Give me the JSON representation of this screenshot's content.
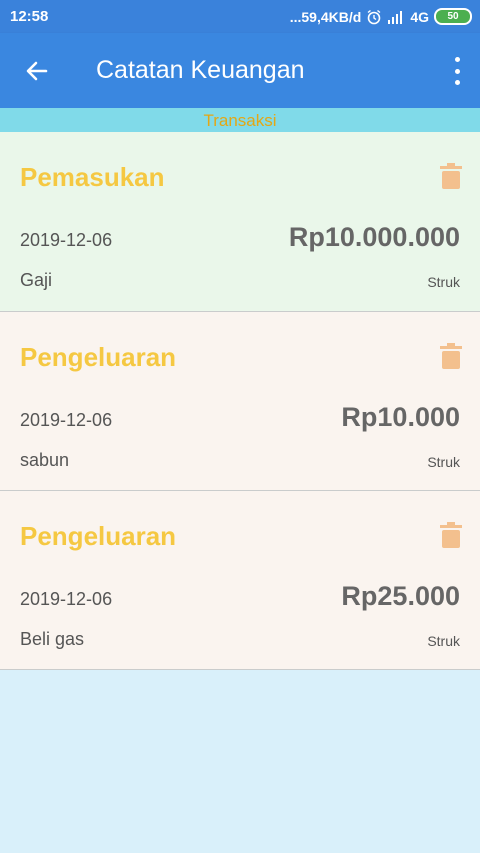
{
  "status_bar": {
    "time": "12:58",
    "network_speed": "...59,4KB/d",
    "network": "4G",
    "battery": "50"
  },
  "app_bar": {
    "title": "Catatan Keuangan",
    "back_icon": "arrow-left-icon",
    "menu_icon": "more-vert-icon"
  },
  "tab": {
    "label": "Transaksi"
  },
  "transactions": [
    {
      "type": "Pemasukan",
      "date": "2019-12-06",
      "amount": "Rp10.000.000",
      "description": "Gaji",
      "receipt_label": "Struk"
    },
    {
      "type": "Pengeluaran",
      "date": "2019-12-06",
      "amount": "Rp10.000",
      "description": "sabun",
      "receipt_label": "Struk"
    },
    {
      "type": "Pengeluaran",
      "date": "2019-12-06",
      "amount": "Rp25.000",
      "description": "Beli gas",
      "receipt_label": "Struk"
    }
  ],
  "colors": {
    "app_bar": "#3a87e0",
    "tab_strip": "#80dae9",
    "type_text": "#f5c842",
    "trash_icon": "#f3c08e",
    "income_card": "#eaf7ea",
    "expense_card": "#faf4ef",
    "background": "#d9f0fa"
  }
}
